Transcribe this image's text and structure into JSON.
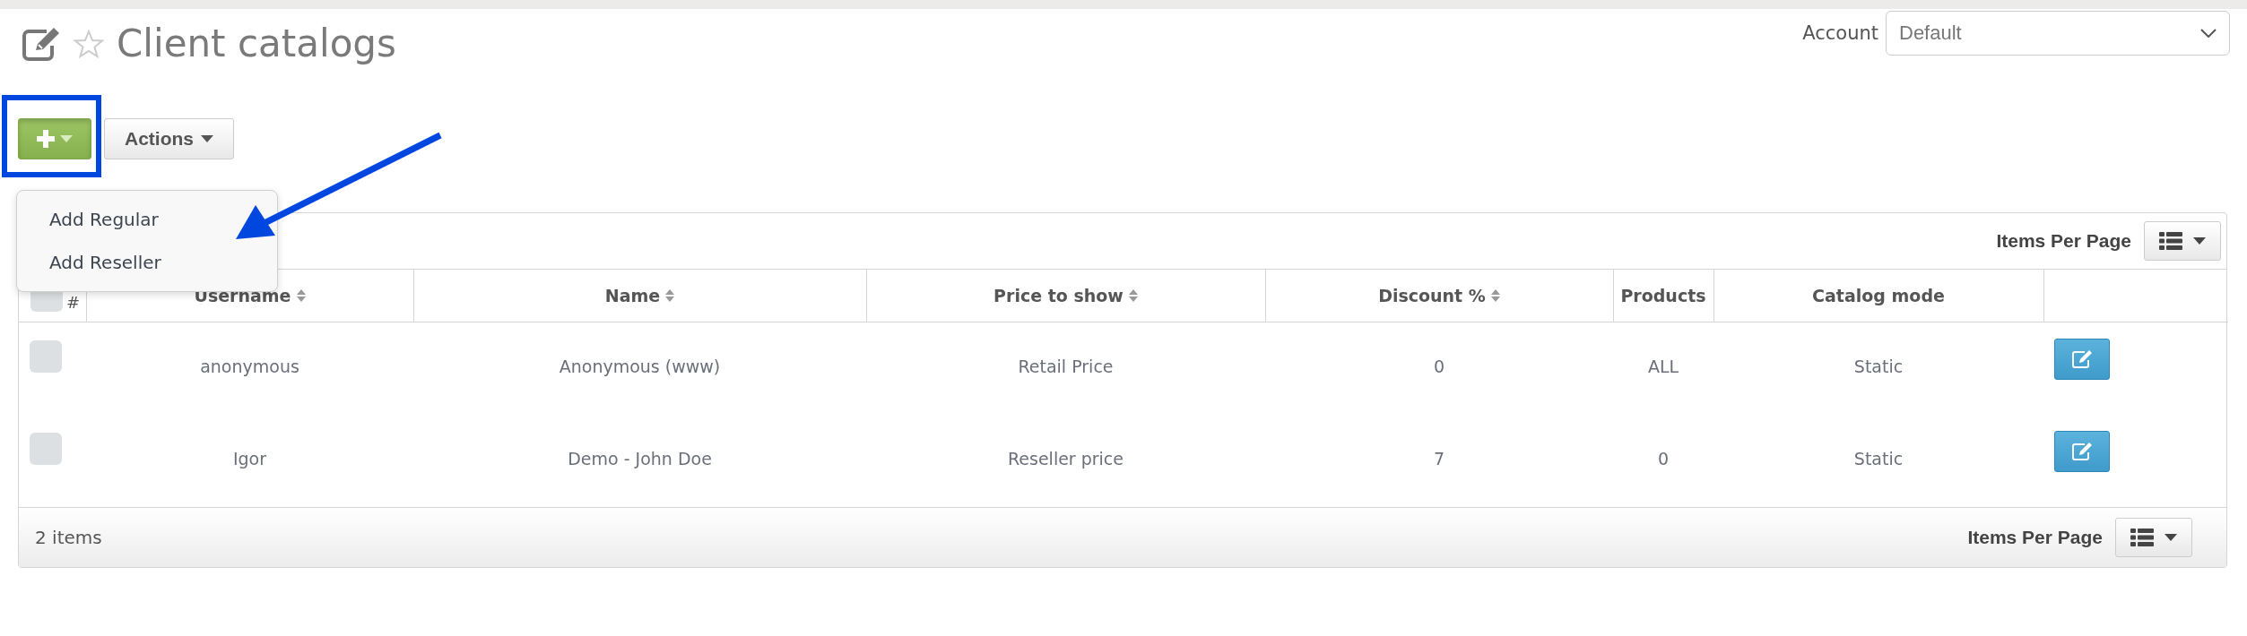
{
  "page": {
    "title": "Client catalogs",
    "favorite": false
  },
  "account": {
    "label": "Account",
    "value": "Default"
  },
  "toolbar": {
    "add_button": {
      "expanded": true
    },
    "actions_button": "Actions"
  },
  "add_menu": [
    {
      "label": "Add Regular"
    },
    {
      "label": "Add Reseller"
    }
  ],
  "table": {
    "items_per_page_label": "Items Per Page",
    "select_all": {
      "label": "#",
      "checked": false
    },
    "columns": [
      {
        "label": "Username",
        "sortable": true
      },
      {
        "label": "Name",
        "sortable": true
      },
      {
        "label": "Price to show",
        "sortable": true
      },
      {
        "label": "Discount %",
        "sortable": true
      },
      {
        "label": "Products",
        "sortable": false
      },
      {
        "label": "Catalog mode",
        "sortable": false
      }
    ],
    "rows": [
      {
        "checked": false,
        "cells": [
          "anonymous",
          "Anonymous (www)",
          "Retail Price",
          "0",
          "ALL",
          "Static"
        ]
      },
      {
        "checked": false,
        "cells": [
          "Igor",
          "Demo - John Doe",
          "Reseller price",
          "7",
          "0",
          "Static"
        ]
      }
    ],
    "footer": {
      "count": "2 items",
      "items_per_page_label": "Items Per Page"
    }
  }
}
